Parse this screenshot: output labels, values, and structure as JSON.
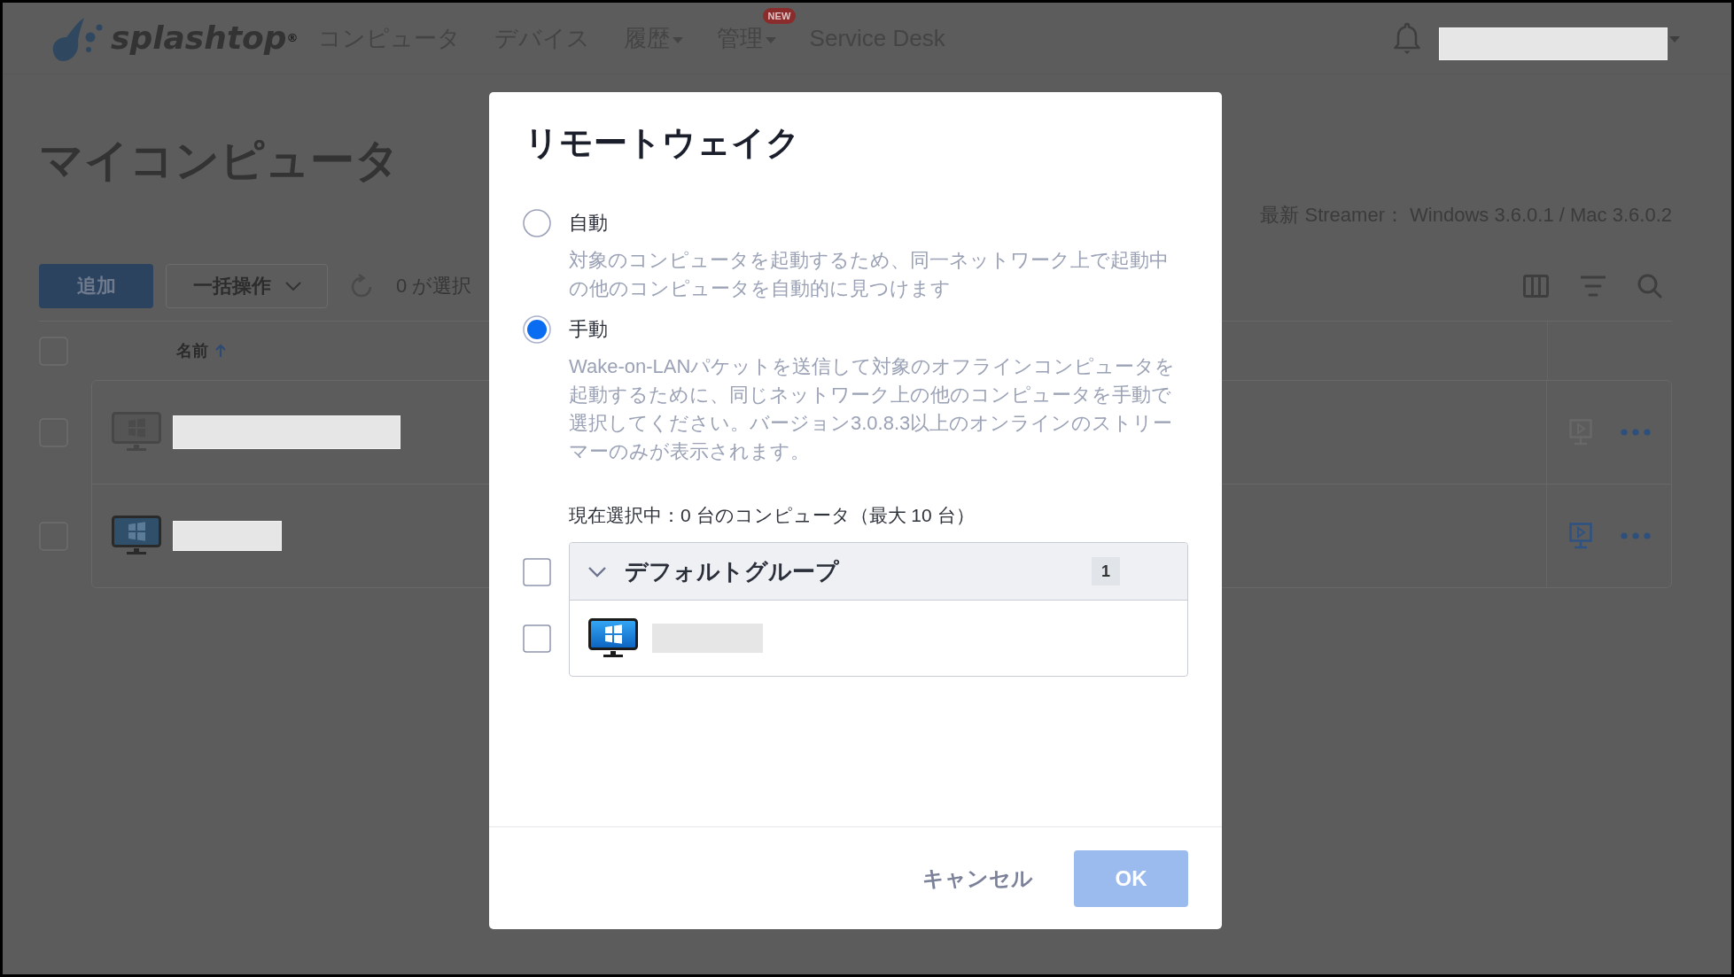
{
  "nav": {
    "logo": "splashtop$^{®}$",
    "items": [
      {
        "label": "コンピュータ",
        "kind": "link"
      },
      {
        "label": "デバイス",
        "kind": "link"
      },
      {
        "label": "履歴",
        "kind": "menu"
      },
      {
        "label": "管理",
        "kind": "menu",
        "badge": "NEW"
      },
      {
        "label": "Service Desk",
        "kind": "link"
      }
    ]
  },
  "page": {
    "title": "マイコンピュータ",
    "streamer_info": "最新 Streamer： Windows 3.6.0.1 / Mac 3.6.0.2",
    "toolbar": {
      "buttons": [
        {
          "label": "追加",
          "kind": "primary"
        },
        {
          "label": "一括操作",
          "kind": "dropdown"
        }
      ],
      "selection_text": "0 が選択"
    },
    "table": {
      "select_all_checked": false,
      "columns": [
        {
          "label": "名前",
          "sorted_ascending": true
        }
      ],
      "rows": [
        {
          "checked": false,
          "online": false
        },
        {
          "checked": false,
          "online": true
        }
      ]
    }
  },
  "dialog": {
    "title": "リモートウェイク",
    "options": [
      {
        "label": "自動",
        "description": "対象のコンピュータを起動するため、同一ネットワーク上で起動中の他のコンピュータを自動的に見つけます",
        "selected": false
      },
      {
        "label": "手動",
        "description": "Wake-on-LANパケットを送信して対象のオフラインコンピュータを起動するために、同じネットワーク上の他のコンピュータを手動で選択してください。バージョン3.0.8.3以上のオンラインのストリーマーのみが表示されます。",
        "selected": true
      }
    ],
    "selection_summary": "現在選択中：0 台のコンピュータ（最大 10 台）",
    "group": {
      "name": "デフォルトグループ",
      "count": "1",
      "expanded": true,
      "checked": false,
      "computers": [
        {
          "checked": false,
          "online": true
        }
      ]
    },
    "buttons": [
      {
        "label": "キャンセル",
        "kind": "text",
        "disabled": false
      },
      {
        "label": "OK",
        "kind": "primary",
        "disabled": true
      }
    ]
  }
}
